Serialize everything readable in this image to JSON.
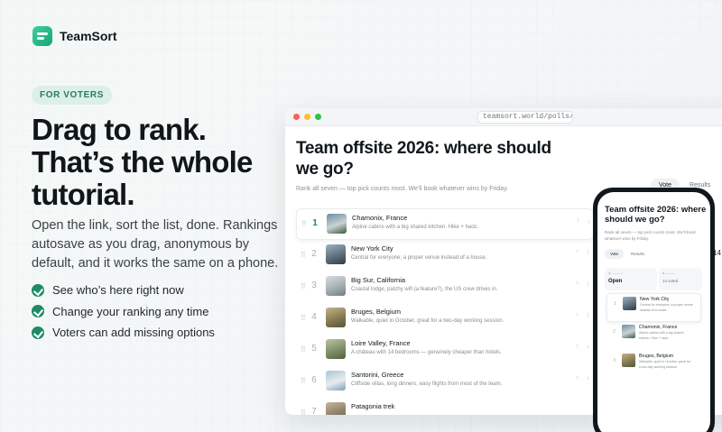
{
  "brand": {
    "name": "TeamSort"
  },
  "hero": {
    "pill": "FOR VOTERS",
    "headline": [
      "Drag to rank.",
      "That’s the whole",
      "tutorial."
    ],
    "lead": "Open the link, sort the list, done. Rankings autosave as you drag, anonymous by default, and it works the same on a phone.",
    "bullets": [
      "See who’s here right now",
      "Change your ranking any time",
      "Voters can add missing options"
    ]
  },
  "browser": {
    "url": "teamsort.world/polls/…",
    "title": "Team offsite 2026: where should we go?",
    "subtitle": "Rank all seven — top pick counts most. We’ll book whatever wins by Friday.",
    "tabs": [
      "Vote",
      "Results"
    ],
    "active_tab": "Vote",
    "rows": [
      {
        "rank": "1",
        "name": "Chamonix, France",
        "desc": "Alpine cabins with a big shared kitchen. Hike + hack."
      },
      {
        "rank": "2",
        "name": "New York City",
        "desc": "Central for everyone; a proper venue instead of a house."
      },
      {
        "rank": "3",
        "name": "Big Sur, California",
        "desc": "Coastal lodge, patchy wifi (a feature?), the US crew drives in."
      },
      {
        "rank": "4",
        "name": "Bruges, Belgium",
        "desc": "Walkable, quiet in October, great for a two-day working session."
      },
      {
        "rank": "5",
        "name": "Loire Valley, France",
        "desc": "A château with 14 bedrooms — genuinely cheaper than hotels."
      },
      {
        "rank": "6",
        "name": "Santorini, Greece",
        "desc": "Cliffside villas, long dinners, easy flights from most of the team."
      },
      {
        "rank": "7",
        "name": "Patagonia trek",
        "desc": ""
      }
    ]
  },
  "phone": {
    "title": "Team offsite 2026: where should we go?",
    "subtitle": "Rank all seven — top pick counts most. We’ll book whatever wins by Friday.",
    "tabs": [
      "Vote",
      "Results"
    ],
    "status_value": "Open",
    "status_card2_value": "14 voted",
    "rows": [
      {
        "rank": "1",
        "name": "New York City",
        "desc": "Central for everyone; a proper venue instead of a house."
      },
      {
        "rank": "2",
        "name": "Chamonix, France",
        "desc": "Alpine cabins with a big shared kitchen. Hike + hack."
      },
      {
        "rank": "3",
        "name": "Bruges, Belgium",
        "desc": "Walkable, quiet in October, great for a two-day working session."
      }
    ]
  },
  "side_number": "14",
  "colors": {
    "accent": "#1f8a67",
    "pill_bg": "#dcefe9"
  }
}
